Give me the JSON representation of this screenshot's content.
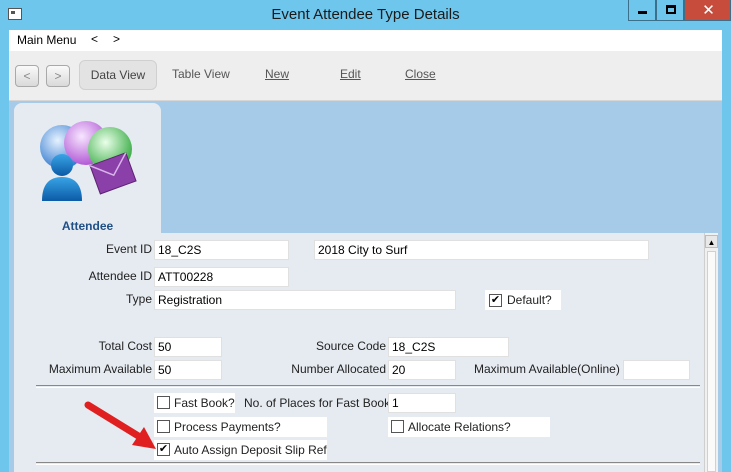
{
  "window": {
    "title": "Event Attendee Type Details"
  },
  "menubar": {
    "main_menu": "Main Menu",
    "back": "<",
    "forward": ">"
  },
  "toolbar": {
    "prev": "<",
    "next": ">",
    "data_view": "Data View",
    "table_view": "Table View",
    "new": "New",
    "edit": "Edit",
    "close": "Close"
  },
  "side_tab": {
    "label": "Attendee",
    "icon": "attendee-people-envelope-icon"
  },
  "form": {
    "event_id": {
      "label": "Event ID",
      "value": "18_C2S",
      "description": "2018 City to Surf"
    },
    "attendee_id": {
      "label": "Attendee ID",
      "value": "ATT00228"
    },
    "type": {
      "label": "Type",
      "value": "Registration"
    },
    "default": {
      "label": "Default?",
      "checked": true
    },
    "total_cost": {
      "label": "Total Cost",
      "value": "50"
    },
    "source_code": {
      "label": "Source Code",
      "value": "18_C2S"
    },
    "maximum_available": {
      "label": "Maximum Available",
      "value": "50"
    },
    "number_allocated": {
      "label": "Number Allocated",
      "value": "20"
    },
    "maximum_available_online": {
      "label": "Maximum Available(Online)",
      "value": ""
    },
    "fast_book": {
      "label": "Fast Book?",
      "checked": false
    },
    "places_fast_book": {
      "label": "No. of Places for Fast Book",
      "value": "1"
    },
    "process_payments": {
      "label": "Process Payments?",
      "checked": false
    },
    "allocate_relations": {
      "label": "Allocate Relations?",
      "checked": false
    },
    "auto_assign_deposit": {
      "label": "Auto Assign Deposit Slip Ref",
      "checked": true
    }
  },
  "colors": {
    "title_bar": "#6fc6ec",
    "close_button": "#c74c3c",
    "content_background": "#a5cbe8",
    "annotation_arrow": "#e02020"
  }
}
